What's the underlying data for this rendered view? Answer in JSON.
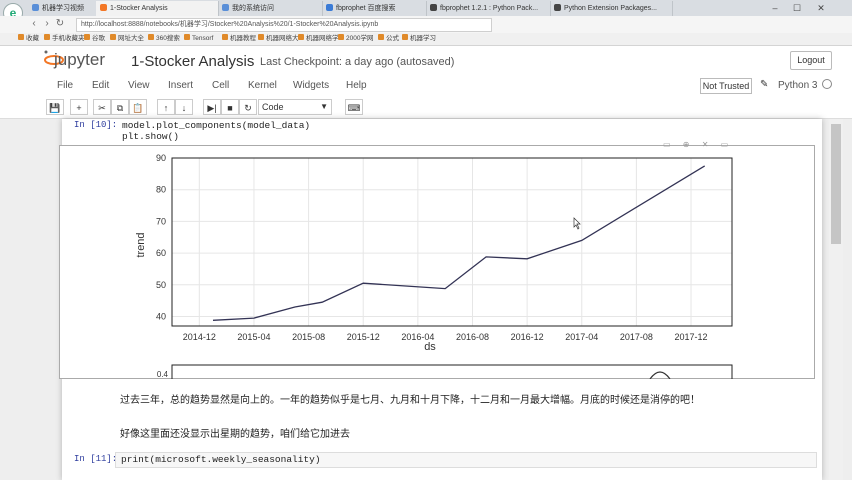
{
  "browser": {
    "tabs": [
      {
        "label": "机器学习视频"
      },
      {
        "label": "1-Stocker Analysis"
      },
      {
        "label": "我的系统访问"
      },
      {
        "label": "fbprophet 百度搜索"
      },
      {
        "label": "fbprophet 1.2.1 : Python Pack..."
      },
      {
        "label": "Python Extension Packages..."
      }
    ],
    "address": "http://localhost:8888/notebooks/机器学习/Stocker%20Analysis%20/1-Stocker%20Analysis.ipynb",
    "bookmarks": [
      "收藏",
      "手机收藏夹",
      "谷歌",
      "网址大全",
      "360搜索",
      "Tensorf",
      "机器教程",
      "机器网络大",
      "机器网络学",
      "2000学网",
      "公式",
      "机器学习"
    ]
  },
  "jupyter": {
    "logo": "jupyter",
    "notebook_name": "1-Stocker Analysis",
    "checkpoint": "Last Checkpoint: a day ago (autosaved)",
    "logout": "Logout",
    "menu": [
      "File",
      "Edit",
      "View",
      "Insert",
      "Cell",
      "Kernel",
      "Widgets",
      "Help"
    ],
    "trusted": "Not Trusted",
    "kernel": "Python 3",
    "cell_type": "Code"
  },
  "cells": {
    "c1_prompt": "In [10]:",
    "c1_line1": "model.plot_components(model_data)",
    "c1_line2": "plt.show()",
    "markdown1": "过去三年，总的趋势显然是向上的。一年的趋势似乎是七月、九月和十月下降，十二月和一月最大增幅。月底的时候还是消停的吧！",
    "markdown2": "好像这里面还没显示出星期的趋势，咱们给它加进去",
    "c2_prompt": "In [11]:",
    "c2_line1": "print(microsoft.weekly_seasonality)"
  },
  "chart_data": {
    "type": "line",
    "xlabel": "ds",
    "ylabel": "trend",
    "ylim": [
      37,
      90
    ],
    "yticks": [
      40,
      50,
      60,
      70,
      80,
      90
    ],
    "xticks": [
      "2014-12",
      "2015-04",
      "2015-08",
      "2015-12",
      "2016-04",
      "2016-08",
      "2016-12",
      "2017-04",
      "2017-08",
      "2017-12"
    ],
    "x": [
      "2015-01",
      "2015-04",
      "2015-07",
      "2015-09",
      "2015-12",
      "2016-06",
      "2016-09",
      "2016-12",
      "2017-04",
      "2018-01"
    ],
    "y": [
      38.8,
      39.5,
      43.0,
      44.5,
      50.5,
      48.8,
      58.8,
      58.2,
      64.0,
      87.5
    ],
    "grid": true,
    "second_chart_visible_ytick": "0.4",
    "line_color": "#333355"
  }
}
